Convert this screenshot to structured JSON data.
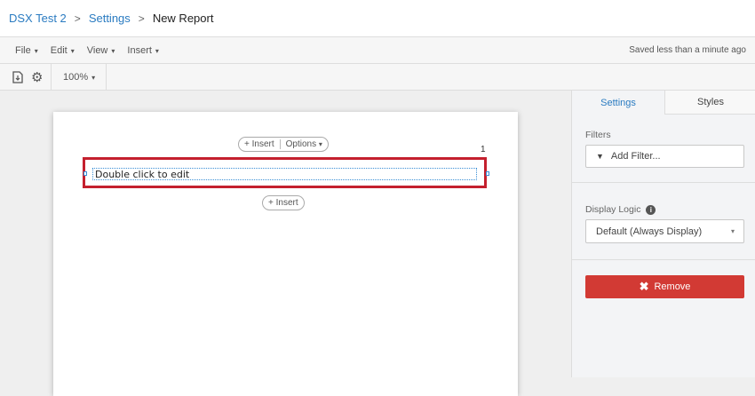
{
  "breadcrumb": {
    "items": [
      "DSX Test 2",
      "Settings"
    ],
    "current": "New Report"
  },
  "menubar": {
    "items": [
      "File",
      "Edit",
      "View",
      "Insert"
    ],
    "saved_status": "Saved less than a minute ago"
  },
  "toolbar": {
    "zoom": "100%"
  },
  "canvas": {
    "insert_label": "Insert",
    "options_label": "Options",
    "block_number": "1",
    "block_text": "Double click to edit"
  },
  "panel": {
    "tabs": [
      "Settings",
      "Styles"
    ],
    "filters_label": "Filters",
    "add_filter": "Add Filter...",
    "display_logic_label": "Display Logic",
    "display_logic_value": "Default (Always Display)",
    "remove_label": "Remove"
  },
  "colors": {
    "accent": "#2a7bc1",
    "danger": "#d23a34",
    "selection": "#c4202e"
  }
}
